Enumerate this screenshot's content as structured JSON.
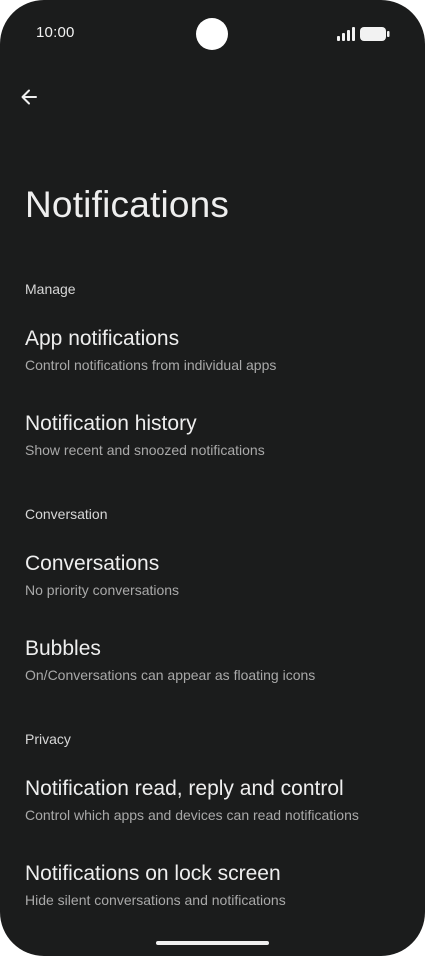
{
  "status_bar": {
    "time": "10:00",
    "icons": [
      "signal-icon",
      "battery-icon"
    ]
  },
  "toolbar": {
    "back_icon": "back-arrow-icon"
  },
  "page": {
    "title": "Notifications"
  },
  "sections": [
    {
      "header": "Manage",
      "items": [
        {
          "title": "App notifications",
          "summary": "Control notifications from individual apps"
        },
        {
          "title": "Notification history",
          "summary": "Show recent and snoozed notifications"
        }
      ]
    },
    {
      "header": "Conversation",
      "items": [
        {
          "title": "Conversations",
          "summary": "No priority conversations"
        },
        {
          "title": "Bubbles",
          "summary": "On/Conversations can appear as floating icons"
        }
      ]
    },
    {
      "header": "Privacy",
      "items": [
        {
          "title": "Notification read, reply and control",
          "summary": "Control which apps and devices can read notifications"
        },
        {
          "title": "Notifications on lock screen",
          "summary": "Hide silent conversations and notifications"
        }
      ]
    }
  ],
  "colors": {
    "background": "#1b1c1c",
    "primary_text": "#eeeeee",
    "secondary_text": "#a9a9a9"
  }
}
